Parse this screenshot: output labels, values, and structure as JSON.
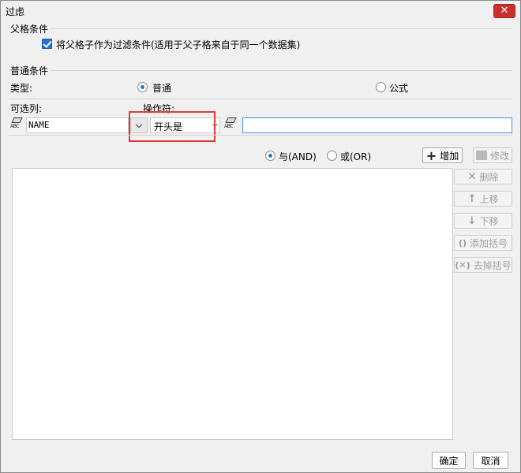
{
  "window": {
    "title": "过虑"
  },
  "parent": {
    "group_title": "父格条件",
    "checkbox_label": "将父格子作为过滤条件(适用于父子格来自于同一个数据集)",
    "checked": true
  },
  "normal": {
    "group_title": "普通条件",
    "type_label": "类型:",
    "type_options": [
      "普通",
      "公式"
    ],
    "selected_type": "普通",
    "column_label": "可选列:",
    "operator_label": "操作符:",
    "column_value": "NAME",
    "operator_value": "开头是",
    "condition_value": ""
  },
  "logic": {
    "and_label": "与(AND)",
    "or_label": "或(OR)",
    "selected": "AND"
  },
  "actions": {
    "add": "增加",
    "modify": "修改",
    "delete": "删除",
    "move_up": "上移",
    "move_down": "下移",
    "add_bracket": "添加括号",
    "remove_bracket": "去掉括号"
  },
  "footer": {
    "ok": "确定",
    "cancel": "取消"
  },
  "colors": {
    "accent": "#2a6fd6",
    "highlight": "#e23b3b",
    "close": "#c9302c"
  }
}
